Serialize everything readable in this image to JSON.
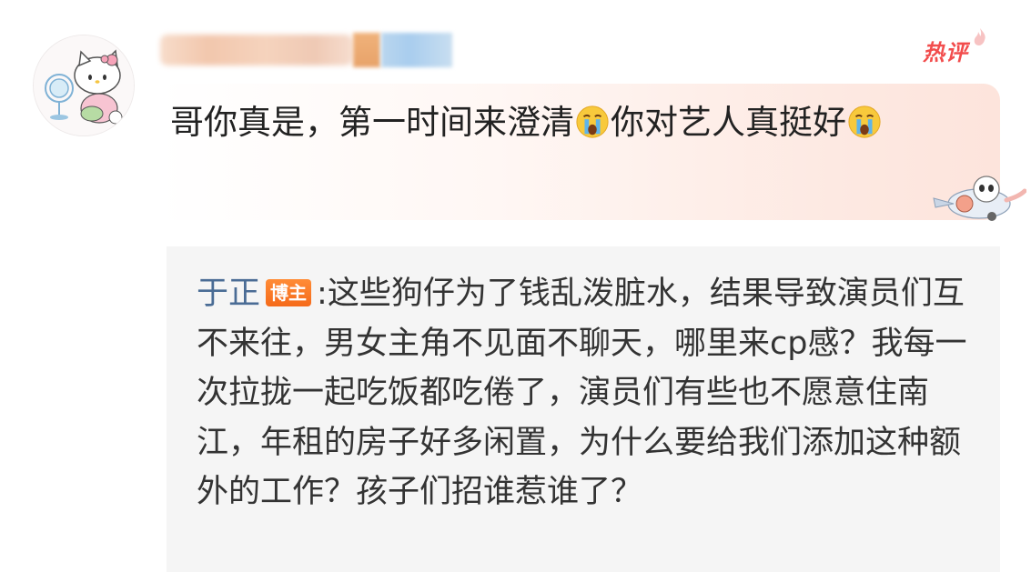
{
  "header": {
    "hot_badge": "热评"
  },
  "comment": {
    "text_part1": "哥你真是，第一时间来澄清",
    "text_part2": "你对艺人真挺好",
    "emoji": "crying-face-emoji"
  },
  "reply": {
    "author": "于正",
    "badge": "博主",
    "separator": ":",
    "text": "这些狗仔为了钱乱泼脏水，结果导致演员们互不来往，男女主角不见面不聊天，哪里来cp感？我每一次拉拢一起吃饭都吃倦了，演员们有些也不愿意住南江，年租的房子好多闲置，为什么要给我们添加这种额外的工作？孩子们招谁惹谁了？"
  },
  "colors": {
    "author_link": "#4a6c95",
    "hot_red": "#f24d4d",
    "badge_orange": "#f56a1a"
  }
}
